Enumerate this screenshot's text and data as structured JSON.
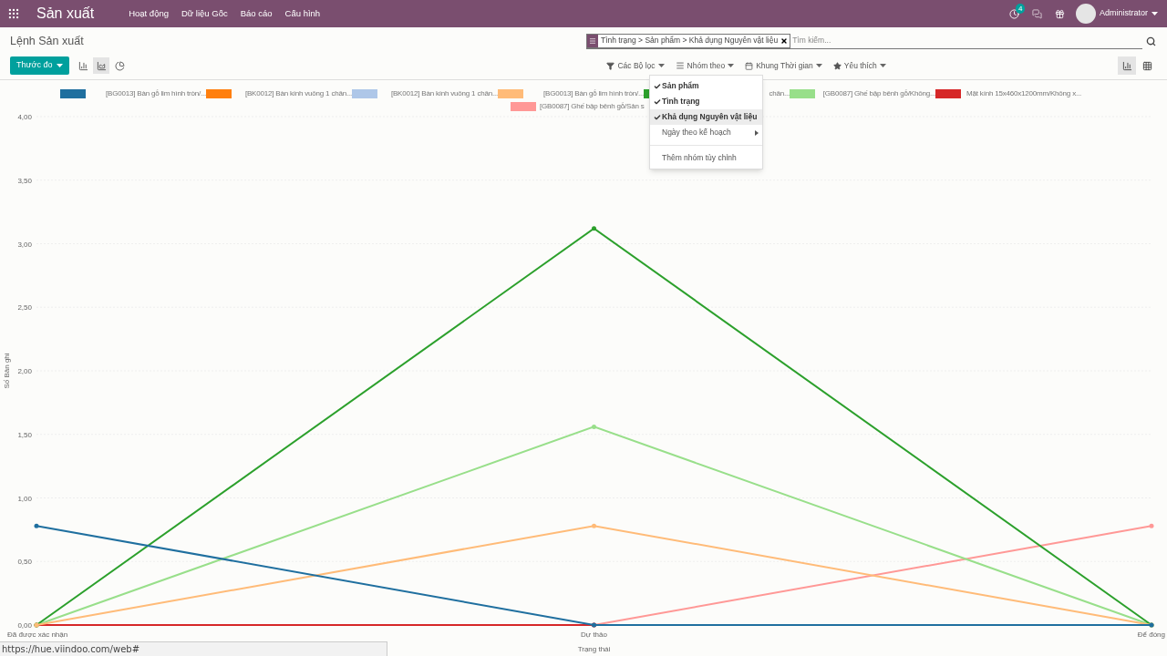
{
  "navbar": {
    "app_title": "Sản xuất",
    "menu": [
      "Hoạt động",
      "Dữ liệu Gốc",
      "Báo cáo",
      "Cấu hình"
    ],
    "activity_badge": "4",
    "user": "Administrator"
  },
  "control_panel": {
    "breadcrumb": "Lệnh Sản xuất",
    "search": {
      "facet": "Tình trạng > Sản phẩm > Khả dụng Nguyên vật liệu",
      "placeholder": "Tìm kiếm..."
    },
    "measure_button": "Thước đo",
    "chart_types": [
      {
        "kind": "bar",
        "selected": false
      },
      {
        "kind": "line",
        "selected": true
      },
      {
        "kind": "pie",
        "selected": false
      }
    ],
    "filters": [
      {
        "kind": "filter",
        "label": "Các Bộ lọc"
      },
      {
        "kind": "group",
        "label": "Nhóm theo"
      },
      {
        "kind": "time",
        "label": "Khung Thời gian"
      },
      {
        "kind": "favorite",
        "label": "Yêu thích"
      }
    ],
    "views": [
      {
        "kind": "graph",
        "selected": true
      },
      {
        "kind": "pivot",
        "selected": false
      }
    ]
  },
  "group_by_menu": {
    "items": [
      {
        "kind": "option",
        "label": "Sản phẩm",
        "checked": true,
        "hovered": false
      },
      {
        "kind": "option",
        "label": "Tình trạng",
        "checked": true,
        "hovered": false
      },
      {
        "kind": "option",
        "label": "Khả dụng Nguyên vật liệu",
        "checked": true,
        "hovered": true
      },
      {
        "kind": "submenu",
        "label": "Ngày theo kế hoạch",
        "checked": false,
        "hovered": false
      },
      {
        "kind": "custom",
        "label": "Thêm nhóm tùy chỉnh",
        "checked": false,
        "hovered": false
      }
    ]
  },
  "chart": {
    "chart_data": {
      "type": "line",
      "grid": true,
      "xlabel": "Trạng thái",
      "ylabel": "Số Bản ghi",
      "categories": [
        "Đã được xác nhận",
        "Dự thảo",
        "Để đóng"
      ],
      "ylim": [
        0,
        4
      ],
      "yticks": [
        {
          "value": 0,
          "label": "0,00"
        },
        {
          "value": 0.5,
          "label": "0,50"
        },
        {
          "value": 1,
          "label": "1,00"
        },
        {
          "value": 1.5,
          "label": "1,50"
        },
        {
          "value": 2,
          "label": "2,00"
        },
        {
          "value": 2.5,
          "label": "2,50"
        },
        {
          "value": 3,
          "label": "3,00"
        },
        {
          "value": 3.5,
          "label": "3,50"
        },
        {
          "value": 4,
          "label": "4,00"
        }
      ],
      "series": [
        {
          "name": "[BG0013] Bàn gỗ lim hình tròn/...",
          "color": "#1f6f9f",
          "values": [
            0.78,
            0,
            0
          ]
        },
        {
          "name": "[BK0012] Bàn kính vuông 1 chân...",
          "color": "#ff7f0e",
          "values": [
            null,
            null,
            null
          ]
        },
        {
          "name": "[BK0012] Bàn kính vuông 1 chân...",
          "color": "#aec7e8",
          "values": [
            null,
            null,
            null
          ]
        },
        {
          "name": "[BG0013] Bàn gỗ lim hình tròn/...",
          "color": "#ffbb78",
          "values": [
            0,
            0.78,
            0
          ]
        },
        {
          "name": "chân...",
          "color": "#2ca02c",
          "values": [
            0,
            3.12,
            0
          ]
        },
        {
          "name": "[GB0087] Ghế bập bênh gỗ/Không...",
          "color": "#98df8a",
          "values": [
            0,
            1.56,
            0
          ]
        },
        {
          "name": "Mặt kính 15x460x1200mm/Không x...",
          "color": "#d62728",
          "values": [
            0,
            0,
            null
          ]
        },
        {
          "name": "[GB0087] Ghế bập bênh gỗ/Sản s",
          "color": "#ff9896",
          "values": [
            null,
            0,
            0.78
          ]
        }
      ]
    }
  },
  "status_url": "https://hue.viindoo.com/web#"
}
